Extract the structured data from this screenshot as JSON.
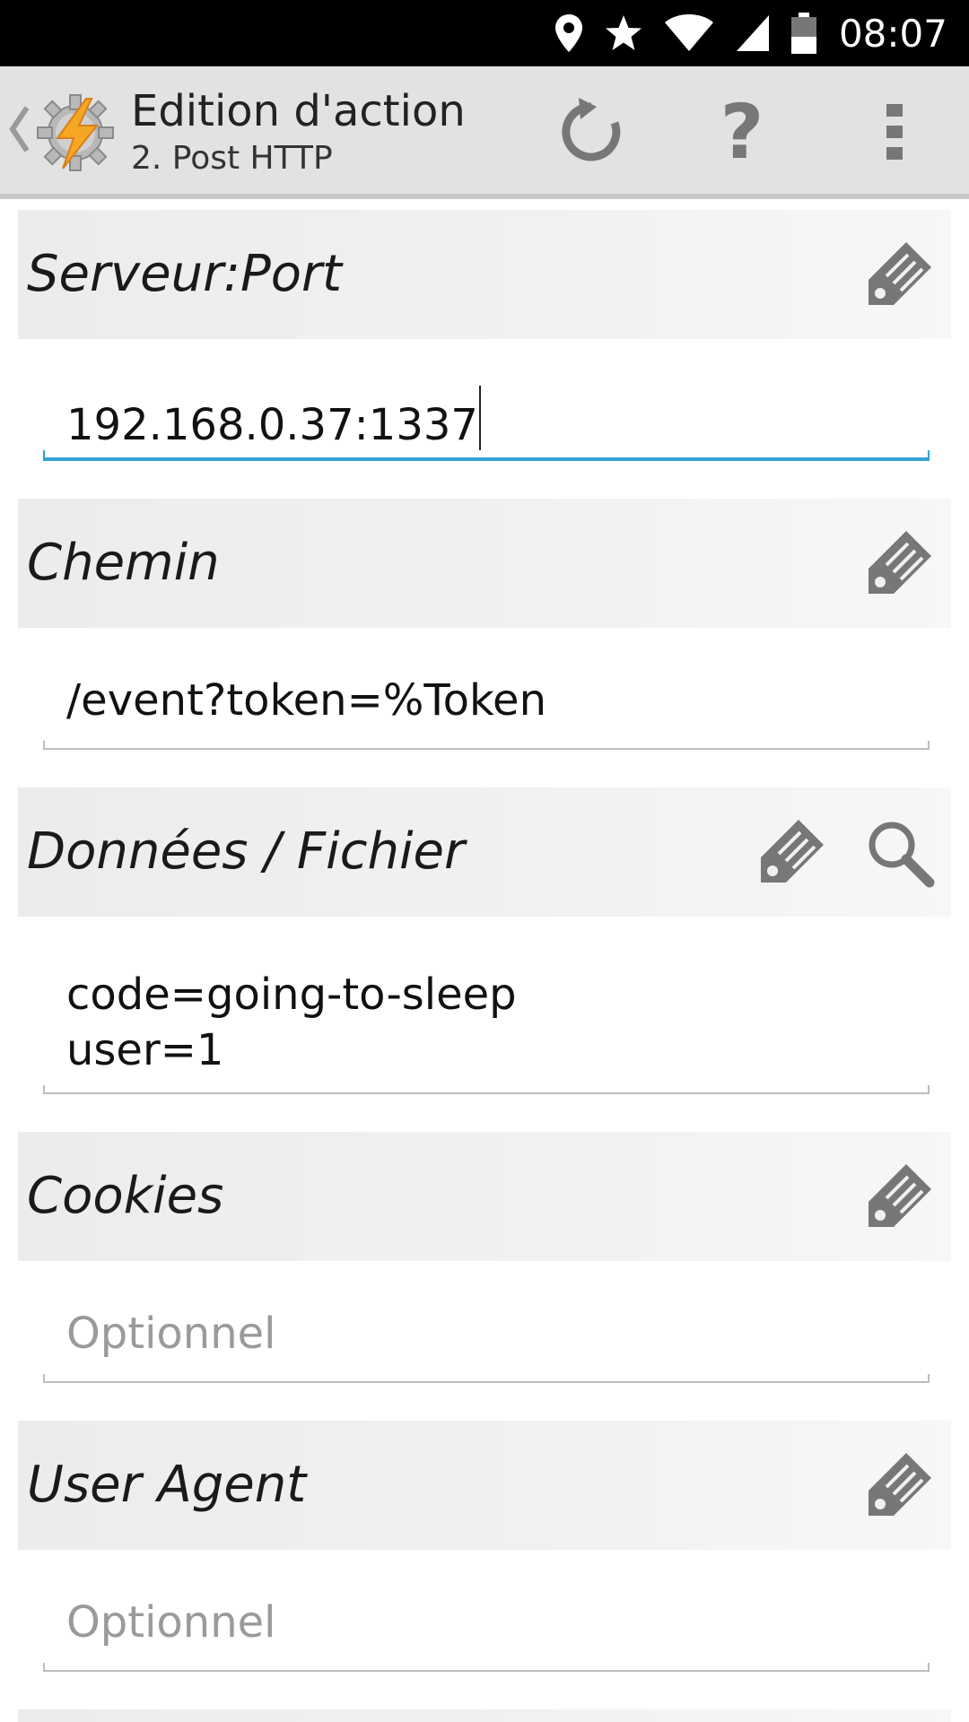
{
  "status_bar": {
    "time": "08:07",
    "icons": [
      "location-icon",
      "star-icon",
      "wifi-icon",
      "cellular-signal-icon",
      "battery-icon"
    ]
  },
  "action_bar": {
    "title": "Edition d'action",
    "subtitle": "2. Post HTTP",
    "help_glyph": "?",
    "icons": [
      "back-chevron-icon",
      "tasker-app-icon",
      "refresh-icon",
      "help-icon",
      "overflow-menu-icon"
    ]
  },
  "sections": {
    "server_port": {
      "label": "Serveur:Port",
      "value": "192.168.0.37:1337"
    },
    "path": {
      "label": "Chemin",
      "value": "/event?token=%Token"
    },
    "data_file": {
      "label": "Données / Fichier",
      "value": "code=going-to-sleep\nuser=1"
    },
    "cookies": {
      "label": "Cookies",
      "placeholder": "Optionnel"
    },
    "user_agent": {
      "label": "User Agent",
      "placeholder": "Optionnel"
    }
  },
  "colors": {
    "status_bar": "#000000",
    "action_bar": "#e2e2e2",
    "section_header": "#eeeeee",
    "focus_underline": "#33a3d4",
    "underline": "#bdbdbd",
    "icon_gray": "#777777",
    "app_icon_bolt": "#f5a623"
  }
}
